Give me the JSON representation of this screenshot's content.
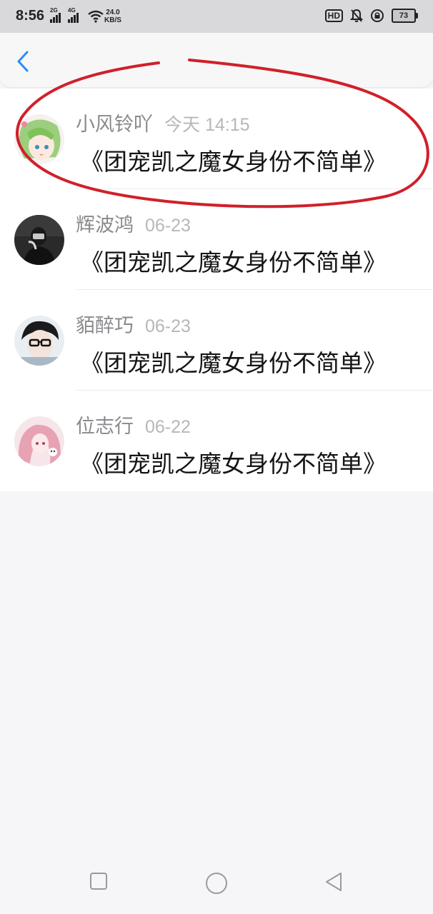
{
  "status_bar": {
    "time": "8:56",
    "signal_1": "2G",
    "signal_2": "4G",
    "speed_value": "24.0",
    "speed_unit": "KB/S",
    "hd_label": "HD",
    "battery": "73",
    "icons": [
      "signal-icon",
      "wifi-icon",
      "hd-icon",
      "mute-icon",
      "lock-rotation-icon",
      "battery-icon"
    ]
  },
  "header": {
    "back_icon": "chevron-left-icon"
  },
  "list": [
    {
      "name": "小风铃吖",
      "time": "今天 14:15",
      "message": "《团宠凯之魔女身份不简单》",
      "avatar": "anime-girl-green-hair"
    },
    {
      "name": "辉波鸿",
      "time": "06-23",
      "message": "《团宠凯之魔女身份不简单》",
      "avatar": "dark-photo-person"
    },
    {
      "name": "貊醉巧",
      "time": "06-23",
      "message": "《团宠凯之魔女身份不简单》",
      "avatar": "boy-with-glasses"
    },
    {
      "name": "位志行",
      "time": "06-22",
      "message": "《团宠凯之魔女身份不简单》",
      "avatar": "anime-girl-pink"
    }
  ],
  "annotation_color": "#d0202a",
  "nav_bar": {
    "buttons": [
      "recent-apps-square-icon",
      "home-circle-icon",
      "back-triangle-icon"
    ]
  }
}
